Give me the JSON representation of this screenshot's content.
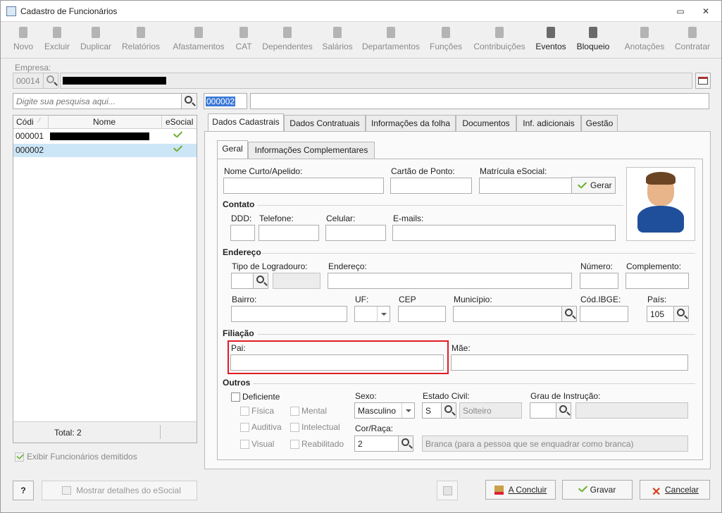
{
  "window": {
    "title": "Cadastro de Funcionários"
  },
  "toolbar": [
    {
      "id": "novo",
      "label": "Novo",
      "icon": "new-document-icon",
      "enabled": false
    },
    {
      "id": "excluir",
      "label": "Excluir",
      "icon": "trash-icon",
      "enabled": false
    },
    {
      "id": "duplicar",
      "label": "Duplicar",
      "icon": "users-icon",
      "enabled": false
    },
    {
      "id": "relatorios",
      "label": "Relatórios",
      "icon": "report-icon",
      "enabled": false
    },
    {
      "id": "afastamentos",
      "label": "Afastamentos",
      "icon": "house-arrow-icon",
      "enabled": false
    },
    {
      "id": "cat",
      "label": "CAT",
      "icon": "plus-circle-icon",
      "enabled": false
    },
    {
      "id": "dependentes",
      "label": "Dependentes",
      "icon": "people-icon",
      "enabled": false
    },
    {
      "id": "salarios",
      "label": "Salários",
      "icon": "money-icon",
      "enabled": false
    },
    {
      "id": "departamentos",
      "label": "Departamentos",
      "icon": "desk-icon",
      "enabled": false
    },
    {
      "id": "funcoes",
      "label": "Funções",
      "icon": "badge-icon",
      "enabled": false
    },
    {
      "id": "contribuicoes",
      "label": "Contribuições",
      "icon": "person-talk-icon",
      "enabled": false
    },
    {
      "id": "eventos",
      "label": "Eventos",
      "icon": "list-icon",
      "enabled": true
    },
    {
      "id": "bloqueio",
      "label": "Bloqueio",
      "icon": "lock-icon",
      "enabled": true
    },
    {
      "id": "anotacoes",
      "label": "Anotações",
      "icon": "note-check-icon",
      "enabled": false
    },
    {
      "id": "contratar",
      "label": "Contratar",
      "icon": "hire-icon",
      "enabled": false
    }
  ],
  "empresa": {
    "label": "Empresa:",
    "code": "00014"
  },
  "search": {
    "placeholder": "Digite sua pesquisa aqui..."
  },
  "current_code": "000002",
  "grid": {
    "headers": [
      "Códi",
      "Nome",
      "eSocial"
    ],
    "rows": [
      {
        "code": "000001"
      },
      {
        "code": "000002"
      }
    ],
    "total": "Total: 2"
  },
  "show_dismissed": "Exibir Funcionários demitidos",
  "tabs": [
    "Dados Cadastrais",
    "Dados Contratuais",
    "Informações da folha",
    "Documentos",
    "Inf. adicionais",
    "Gestão"
  ],
  "subtabs": [
    "Geral",
    "Informações Complementares"
  ],
  "fields": {
    "nome_curto": "Nome Curto/Apelido:",
    "cartao": "Cartão de Ponto:",
    "matricula": "Matrícula eSocial:",
    "gerar": "Gerar",
    "contato": "Contato",
    "ddd": "DDD:",
    "telefone": "Telefone:",
    "celular": "Celular:",
    "emails": "E-mails:",
    "endereco_sec": "Endereço",
    "tipo_log": "Tipo de Logradouro:",
    "endereco": "Endereço:",
    "numero": "Número:",
    "complemento": "Complemento:",
    "bairro": "Bairro:",
    "uf": "UF:",
    "cep": "CEP",
    "municipio": "Município:",
    "cod_ibge": "Cód.IBGE:",
    "pais": "País:",
    "pais_value": "105",
    "filiacao": "Filiação",
    "pai": "Pai:",
    "mae": "Mãe:",
    "outros": "Outros",
    "deficiente": "Deficiente",
    "fisica": "Física",
    "mental": "Mental",
    "auditiva": "Auditiva",
    "intelectual": "Intelectual",
    "visual": "Visual",
    "reabilitado": "Reabilitado",
    "sexo": "Sexo:",
    "sexo_value": "Masculino",
    "estado_civil": "Estado Civil:",
    "estado_civil_code": "S",
    "estado_civil_desc": "Solteiro",
    "grau": "Grau de Instrução:",
    "cor": "Cor/Raça:",
    "cor_code": "2",
    "cor_desc": "Branca (para a pessoa que se enquadrar como branca)"
  },
  "bottom": {
    "help": "?",
    "esocial_details": "Mostrar detalhes do eSocial",
    "concluir": "A Concluir",
    "gravar": "Gravar",
    "cancelar": "Cancelar"
  }
}
